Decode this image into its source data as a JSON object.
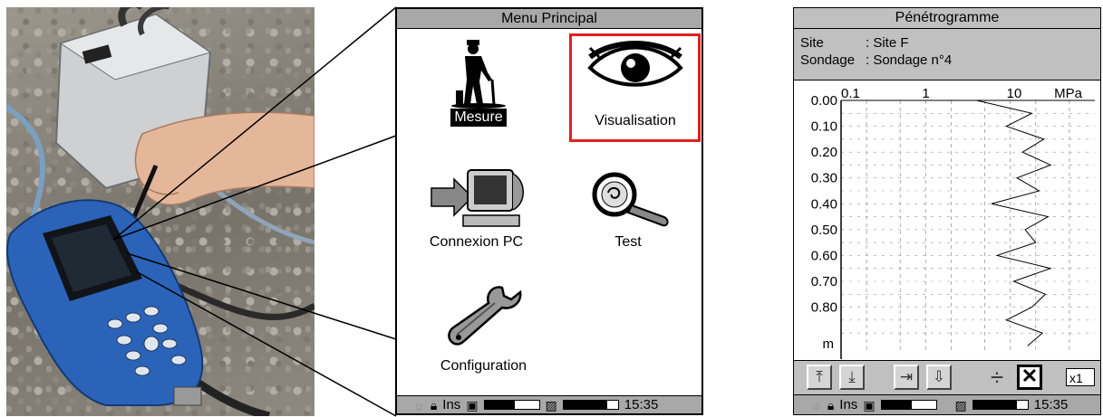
{
  "menu": {
    "title": "Menu Principal",
    "items": [
      {
        "label": "Mesure",
        "icon": "person-measuring-icon"
      },
      {
        "label": "Visualisation",
        "icon": "eye-icon"
      },
      {
        "label": "Connexion PC",
        "icon": "computer-icon"
      },
      {
        "label": "Test",
        "icon": "magnifier-icon"
      },
      {
        "label": "Configuration",
        "icon": "wrench-icon"
      }
    ],
    "selected": "Visualisation"
  },
  "status": {
    "ins": "Ins",
    "time": "15:35",
    "battery1_level": 0.55,
    "battery2_level": 0.8
  },
  "penetrogramme": {
    "title": "Pénétrogramme",
    "site_label": "Site",
    "site_value": ": Site F",
    "sondage_label": "Sondage",
    "sondage_value": ": Sondage n°4",
    "zoom": "x1",
    "colors": {
      "accent": "#e02020",
      "header": "#c0c0c0"
    }
  },
  "chart_data": {
    "type": "line",
    "x_ticks": [
      "0.1",
      "1",
      "10"
    ],
    "x_unit": "MPa",
    "x_scale": "log",
    "y_ticks": [
      "0.00",
      "0.10",
      "0.20",
      "0.30",
      "0.40",
      "0.50",
      "0.60",
      "0.70",
      "0.80"
    ],
    "y_unit": "m",
    "ylim": [
      0,
      0.98
    ],
    "grid": true,
    "series": [
      {
        "values_depth": [
          0.0,
          0.05,
          0.1,
          0.15,
          0.2,
          0.25,
          0.3,
          0.35,
          0.4,
          0.45,
          0.5,
          0.55,
          0.6,
          0.65,
          0.7,
          0.75,
          0.8,
          0.85,
          0.9,
          0.95
        ],
        "values_mpa": [
          4.0,
          18.0,
          9.0,
          25.0,
          14.0,
          30.0,
          12.0,
          22.0,
          6.0,
          28.0,
          15.0,
          20.0,
          7.0,
          30.0,
          11.0,
          26.0,
          18.0,
          9.0,
          24.0,
          16.0
        ]
      }
    ]
  }
}
